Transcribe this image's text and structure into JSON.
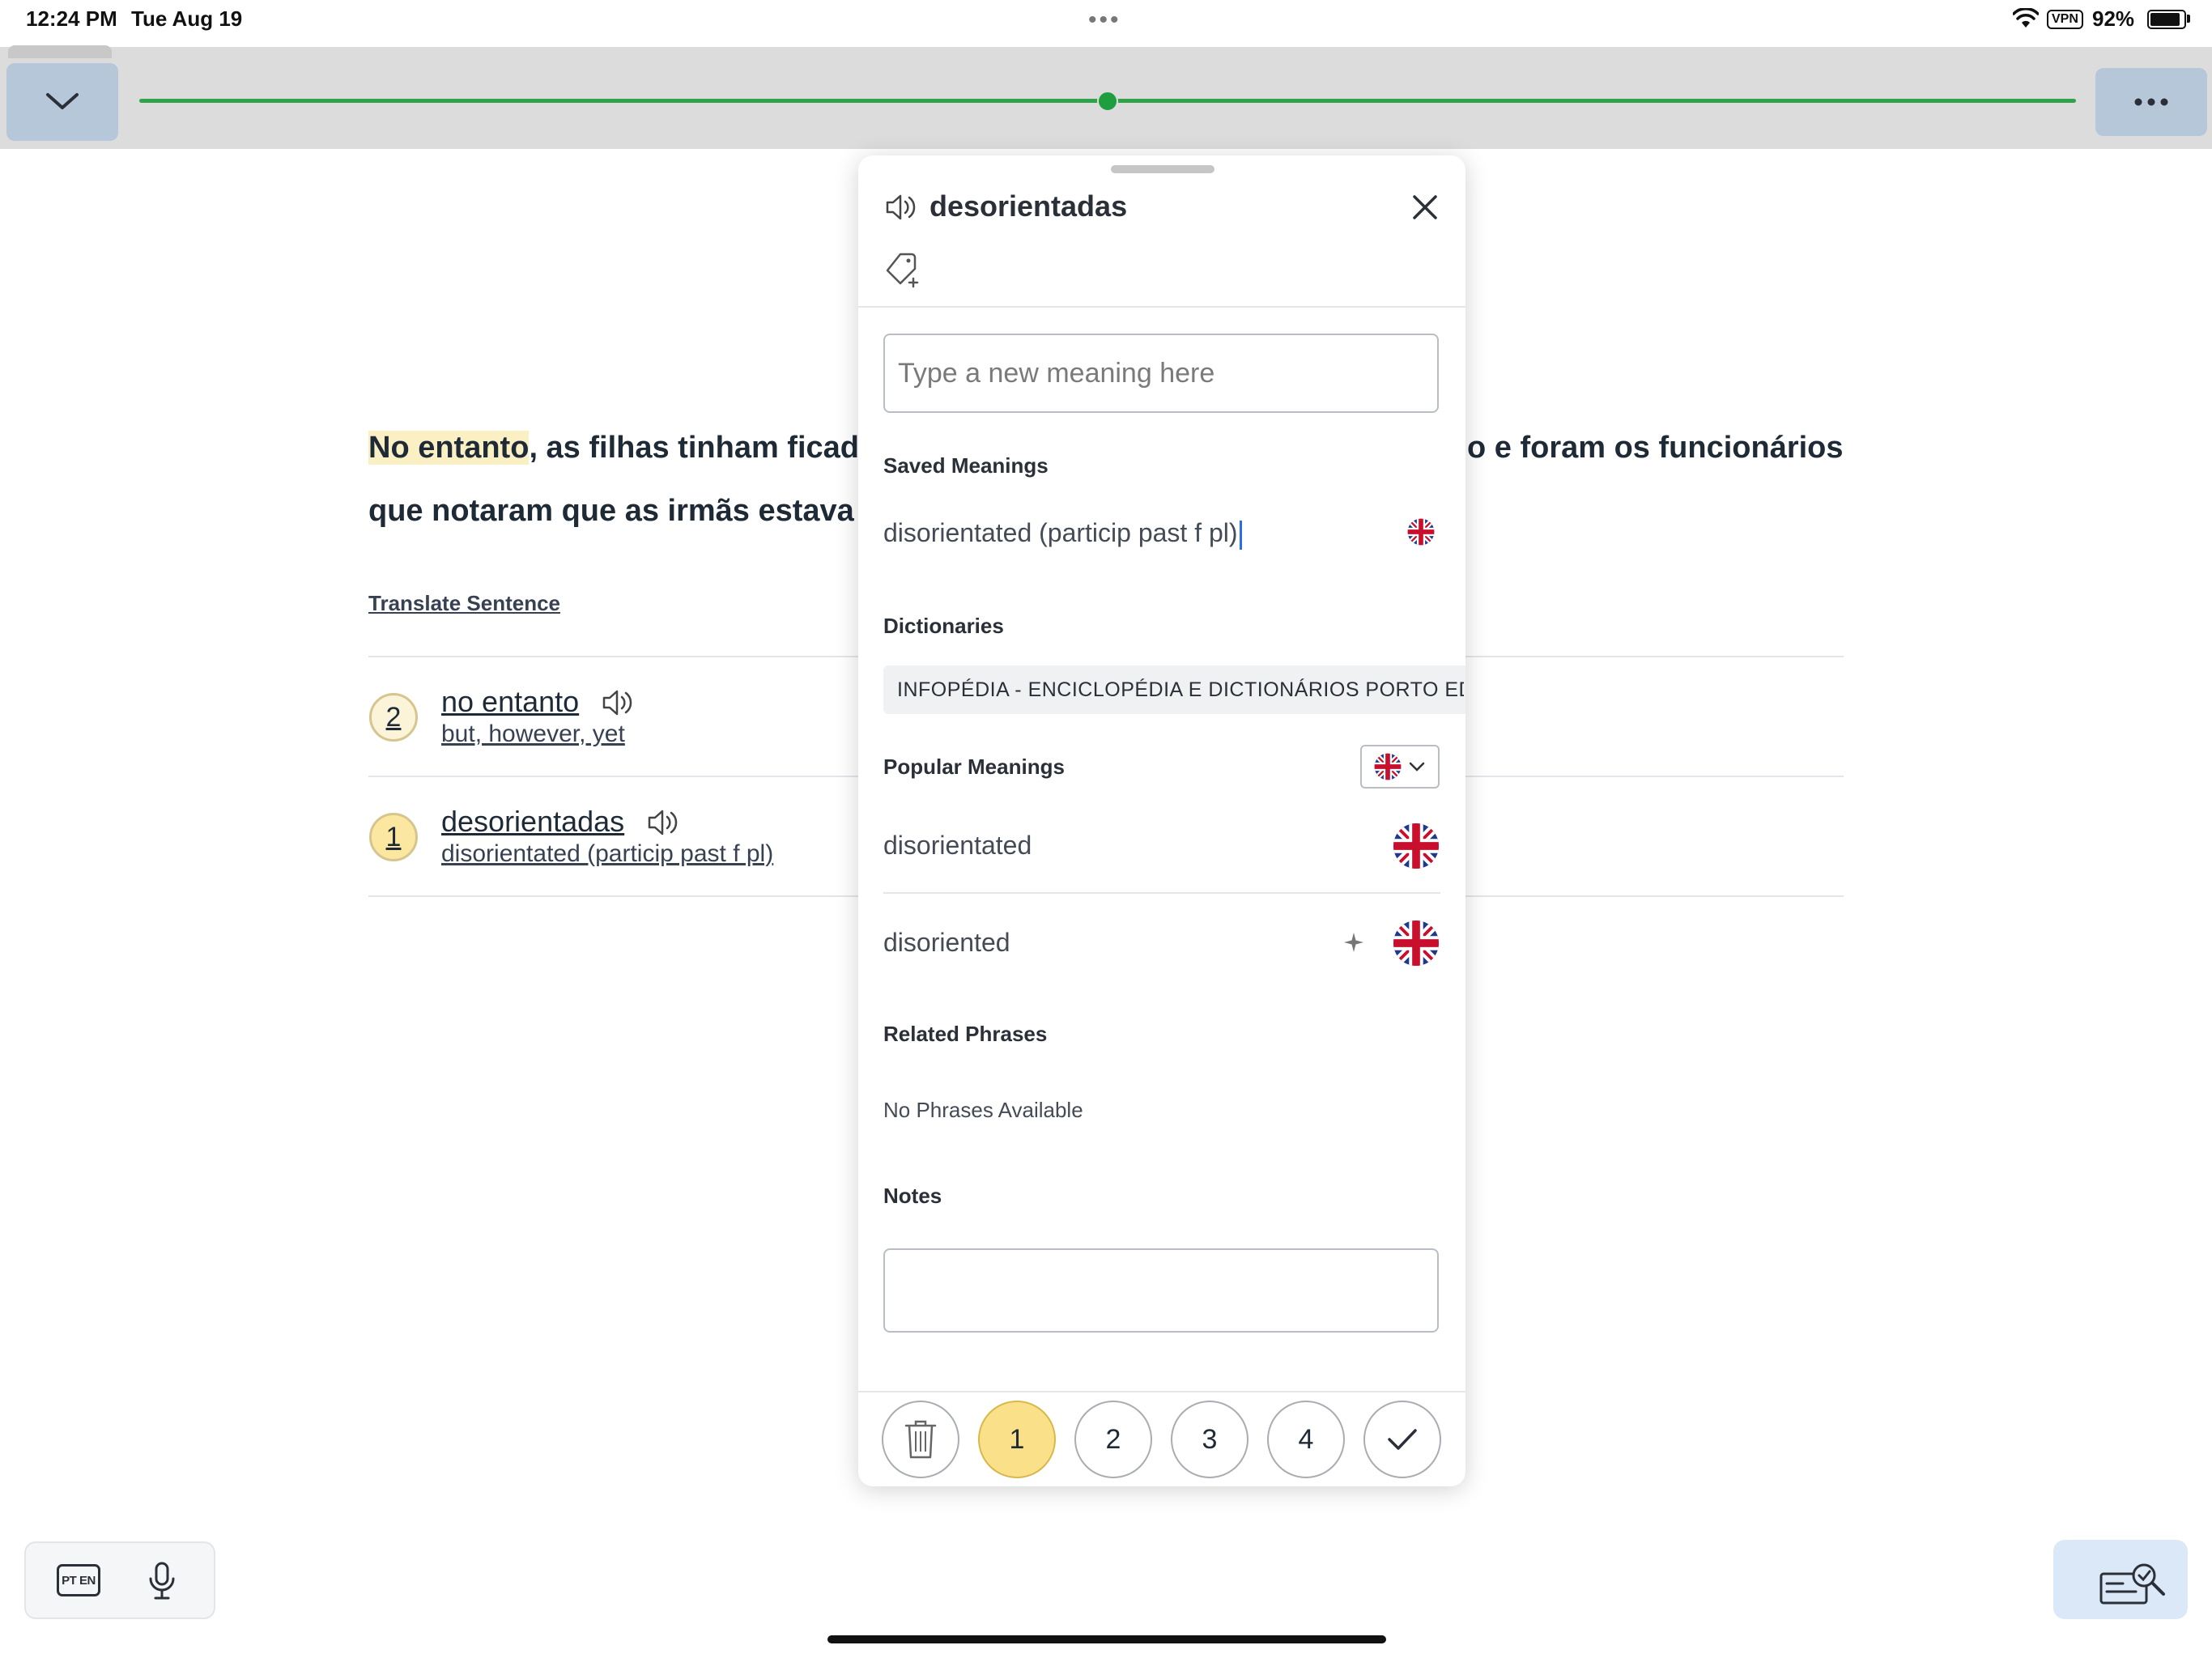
{
  "status_bar": {
    "time": "12:24 PM",
    "date": "Tue Aug 19",
    "vpn": "VPN",
    "battery": "92%",
    "battery_level": 0.92
  },
  "toolbar": {
    "collapse_icon": "chevron-down-icon",
    "more_icon": "ellipsis-icon",
    "reading_progress": 0.5
  },
  "reader": {
    "sentence_highlight": "No entanto",
    "sentence_line1_rest": ", as filhas tinham ficad",
    "sentence_line1_tail": "o e foram os funcionários",
    "sentence_line2": "que notaram que as irmãs estava",
    "translate_link": "Translate Sentence",
    "items": [
      {
        "level": "2",
        "term": "no entanto",
        "meaning": "but, however, yet"
      },
      {
        "level": "1",
        "term": "desorientadas",
        "meaning": "disorientated (particip past f pl)"
      }
    ]
  },
  "popover": {
    "word": "desorientadas",
    "speaker_icon": "speaker-icon",
    "close_icon": "close-icon",
    "tag_icon": "tag-add-icon",
    "new_meaning_placeholder": "Type a new meaning here",
    "saved_meanings_heading": "Saved Meanings",
    "saved_meanings": [
      {
        "text": "disorientated (particip past f pl)",
        "flag": "uk-flag-icon"
      }
    ],
    "dictionaries_heading": "Dictionaries",
    "dictionary_name": "INFOPÉDIA - ENCICLOPÉDIA E DICTIONÁRIOS PORTO EDITORA",
    "popular_meanings_heading": "Popular Meanings",
    "popular_meanings": [
      {
        "text": "disorientated",
        "flag": "uk-flag-icon"
      },
      {
        "text": "disoriented",
        "flag": "uk-flag-icon",
        "extra_icon": "sparkle-icon"
      }
    ],
    "related_phrases_heading": "Related Phrases",
    "related_phrases_empty": "No Phrases Available",
    "notes_heading": "Notes",
    "notes_value": "",
    "level_buttons": [
      "1",
      "2",
      "3",
      "4"
    ],
    "selected_level": "1",
    "delete_icon": "trash-icon",
    "done_icon": "checkmark-icon"
  },
  "dock": {
    "lang_chip": "PT EN",
    "mic_icon": "microphone-icon",
    "review_icon": "review-check-icon"
  }
}
